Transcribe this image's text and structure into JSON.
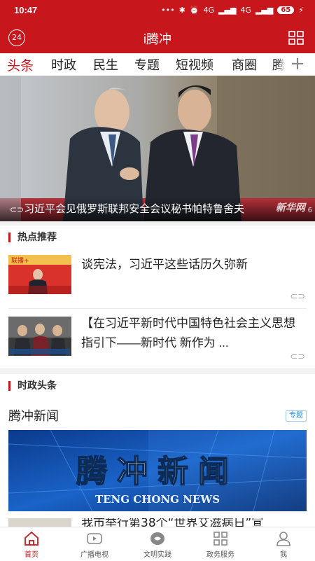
{
  "status_bar": {
    "time": "10:47",
    "signal_1": "4G",
    "signal_2": "4G",
    "battery": "65"
  },
  "app_bar": {
    "title": "i腾冲",
    "weather_badge": "24",
    "menu_icon": "grid-icon"
  },
  "tabs": [
    {
      "label": "头条",
      "active": true
    },
    {
      "label": "时政"
    },
    {
      "label": "民生"
    },
    {
      "label": "专题"
    },
    {
      "label": "短视频"
    },
    {
      "label": "商圈"
    },
    {
      "label": "腾"
    }
  ],
  "tabs_add": "+",
  "hero": {
    "caption": "习近平会见俄罗斯联邦安全会议秘书帕特鲁舍夫",
    "watermark": "新华网",
    "colors": {
      "bg_left": "#b8bcc4",
      "bg_right": "#8b7d68",
      "carpet": "#b8313a"
    }
  },
  "hot_section": {
    "heading": "热点推荐",
    "items": [
      {
        "title": "谈宪法，习近平这些话历久弥新",
        "thumb_label": "联播+"
      },
      {
        "title": "【在习近平新时代中国特色社会主义思想指引下——新时代 新作为 ..."
      }
    ]
  },
  "politics_section": {
    "heading": "时政头条",
    "column_title": "腾冲新闻",
    "column_badge": "专题",
    "banner_text_cn": "腾冲新闻",
    "banner_text_en": "TENG CHONG NEWS",
    "next_item_partial": "我市举行第38个“世界艾滋病日”宣"
  },
  "bottom_nav": [
    {
      "label": "首页",
      "icon": "home-icon",
      "active": true
    },
    {
      "label": "广播电视",
      "icon": "video-icon"
    },
    {
      "label": "文明实践",
      "icon": "practice-icon"
    },
    {
      "label": "政务服务",
      "icon": "grid-services-icon"
    },
    {
      "label": "我",
      "icon": "user-icon"
    }
  ],
  "accent_color": "#c8161d"
}
